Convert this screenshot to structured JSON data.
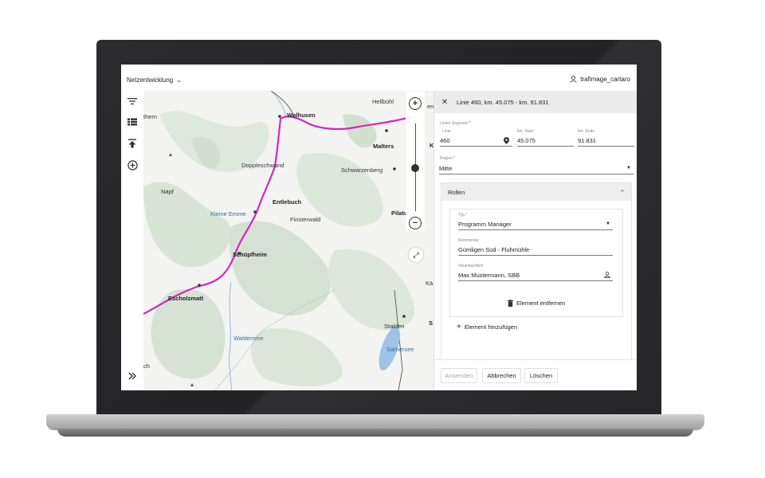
{
  "topbar": {
    "topic": "Netzentwicklung",
    "user": "trafimage_cartaro"
  },
  "toolbar": [
    "filter-icon",
    "list-icon",
    "upload-icon",
    "add-circle-icon",
    "expand-icon"
  ],
  "map": {
    "labels": {
      "hellbuehl": "Hellbühl",
      "wolhusen": "Wolhusen",
      "malters": "Malters",
      "doppleschwand": "Doppleschwand",
      "schwarzenberg": "Schwarzenberg",
      "napf": "Napf",
      "entlebuch": "Entlebuch",
      "kleine_emme": "Kleine Emme",
      "finsterwald": "Finsterwald",
      "pilatus": "Pilatu",
      "schuepfheim": "Schüpfheim",
      "escholzmatt": "Escholzmatt",
      "waldemme": "Waldemme",
      "stalden": "Stalden",
      "sarnersee": "Sarnersee",
      "thern": "thern",
      "ch": "ch",
      "k": "K",
      "ka": "Kä",
      "s": "S",
      "en": "en"
    },
    "route_color": "#d726c0"
  },
  "panel": {
    "title": "Linie 460, km. 45.075 - km. 91.831",
    "section_label": "Linien Segment *",
    "linie_label": "Linie",
    "linie_value": "460",
    "km_start_label": "km. Start",
    "km_start_value": "45.075",
    "km_ende_label": "km. Ende",
    "km_ende_value": "91.831",
    "region_label": "Region *",
    "region_value": "Mitte",
    "rollen_title": "Rollen",
    "typ_label": "Typ *",
    "typ_value": "Programm Manager",
    "kommentar_label": "Kommentar",
    "kommentar_value": "Gümligen Süd - Fluhmühle",
    "verantwortlich_label": "Verantwortlich",
    "verantwortlich_value": "Max Mustermann, SBB",
    "remove_label": "Element entfernen",
    "add_label": "Element hinzufügen",
    "apply_label": "Anwenden",
    "cancel_label": "Abbrechen",
    "delete_label": "Löschen"
  }
}
